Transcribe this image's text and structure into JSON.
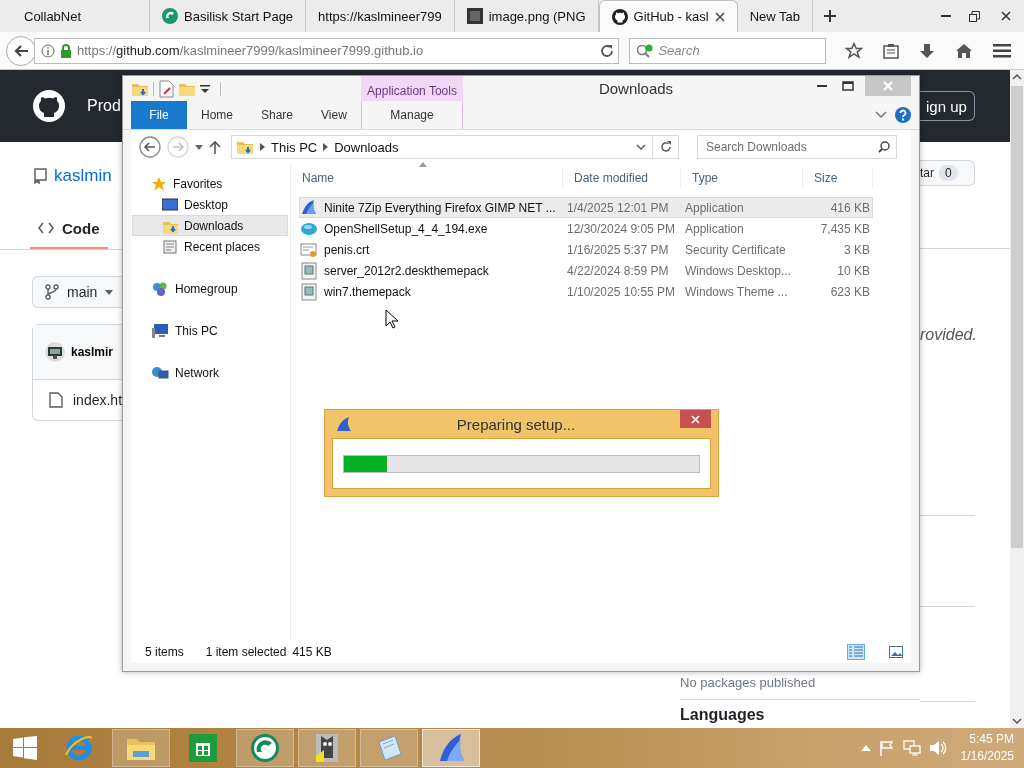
{
  "browser": {
    "tabs": [
      {
        "title": "CollabNet",
        "selected": false
      },
      {
        "title": "Basilisk Start Page",
        "selected": false
      },
      {
        "title": "https://kaslmineer799",
        "selected": false
      },
      {
        "title": "image.png (PNG",
        "selected": false
      },
      {
        "title": "GitHub - kasl",
        "selected": true
      },
      {
        "title": "New Tab",
        "selected": false
      }
    ],
    "address": {
      "scheme": "https://",
      "host": "github.com",
      "path": "/kaslmineer7999/kaslmineer7999.github.io"
    },
    "search": {
      "placeholder": "Search"
    }
  },
  "github_page": {
    "nav_text": "Prod",
    "repo_name": "kaslmin",
    "code_tab": {
      "label": "Code",
      "selected": true
    },
    "branch": "main",
    "owner": "kaslmir",
    "file": "index.ht",
    "signup": "ign up",
    "star": "tar",
    "star_count": "0",
    "about_note": "rovided.",
    "packages_note": "No packages published",
    "languages_heading": "Languages"
  },
  "explorer": {
    "title": "Downloads",
    "context_tab": "Application Tools",
    "ribbon_tabs": [
      {
        "label": "File",
        "kind": "file"
      },
      {
        "label": "Home",
        "kind": "tab"
      },
      {
        "label": "Share",
        "kind": "tab"
      },
      {
        "label": "View",
        "kind": "tab"
      },
      {
        "label": "Manage",
        "kind": "context"
      }
    ],
    "forward": {
      "disabled": true
    },
    "breadcrumb": [
      "This PC",
      "Downloads"
    ],
    "search": {
      "placeholder": "Search Downloads"
    },
    "nav": [
      {
        "label": "Favorites",
        "selected": false,
        "children": [
          {
            "label": "Desktop",
            "selected": false
          },
          {
            "label": "Downloads",
            "selected": true
          },
          {
            "label": "Recent places",
            "selected": false
          }
        ]
      },
      {
        "label": "Homegroup",
        "selected": false
      },
      {
        "label": "This PC",
        "selected": false
      },
      {
        "label": "Network",
        "selected": false
      }
    ],
    "columns": [
      "Name",
      "Date modified",
      "Type",
      "Size"
    ],
    "files": [
      {
        "name": "Ninite 7Zip Everything Firefox GIMP NET ...",
        "date": "1/4/2025 12:01 PM",
        "type": "Application",
        "size": "416 KB",
        "selected": true
      },
      {
        "name": "OpenShellSetup_4_4_194.exe",
        "date": "12/30/2024 9:05 PM",
        "type": "Application",
        "size": "7,435 KB",
        "selected": false
      },
      {
        "name": "penis.crt",
        "date": "1/16/2025 5:37 PM",
        "type": "Security Certificate",
        "size": "3 KB",
        "selected": false
      },
      {
        "name": "server_2012r2.deskthemepack",
        "date": "4/22/2024 8:59 PM",
        "type": "Windows Desktop...",
        "size": "10 KB",
        "selected": false
      },
      {
        "name": "win7.themepack",
        "date": "1/10/2025 10:55 PM",
        "type": "Windows Theme ...",
        "size": "623 KB",
        "selected": false
      }
    ],
    "status": {
      "count": "5 items",
      "selection": "1 item selected",
      "selection_size": "415 KB"
    },
    "view_buttons": [
      {
        "selected": true
      },
      {
        "selected": false
      }
    ]
  },
  "dialog": {
    "title": "Preparing setup...",
    "progress": {
      "level": 0.12
    }
  },
  "taskbar": {
    "apps": [
      {
        "running": false,
        "selected": false
      },
      {
        "running": true,
        "selected": false
      },
      {
        "running": false,
        "selected": false
      },
      {
        "running": true,
        "selected": false
      },
      {
        "running": true,
        "selected": false
      },
      {
        "running": true,
        "selected": false
      },
      {
        "running": true,
        "selected": true
      }
    ],
    "clock": {
      "time": "5:45 PM",
      "date": "1/16/2025"
    }
  }
}
